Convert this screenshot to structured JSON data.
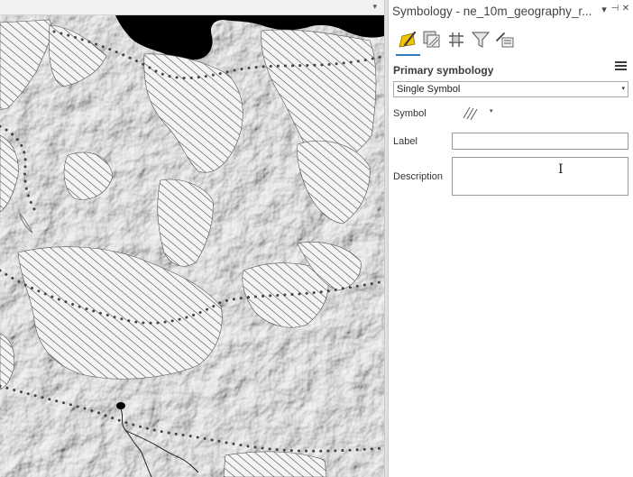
{
  "map": {
    "dropdown_icon": "chevron-down-icon"
  },
  "pane": {
    "title": "Symbology - ne_10m_geography_r...",
    "title_buttons": {
      "dropdown": "▾",
      "pin": "⊣",
      "close": "✕"
    },
    "tabs": [
      {
        "name": "primary-symbology",
        "icon": "paintbrush-icon",
        "active": true
      },
      {
        "name": "vary-symbology",
        "icon": "layers-icon",
        "active": false
      },
      {
        "name": "symbol-layer-drawing",
        "icon": "grid-hash-icon",
        "active": false
      },
      {
        "name": "symbol-classes",
        "icon": "filter-icon",
        "active": false
      },
      {
        "name": "label-classes",
        "icon": "list-edit-icon",
        "active": false
      }
    ],
    "menu_icon": "hamburger-icon",
    "section_heading": "Primary symbology",
    "renderer": {
      "value": "Single Symbol",
      "arrow": "▾"
    },
    "fields": {
      "symbol_label": "Symbol",
      "symbol_arrow": "▾",
      "label_label": "Label",
      "label_value": "",
      "description_label": "Description",
      "description_value": ""
    },
    "cursor_glyph": "I"
  },
  "colors": {
    "accent": "#2d7dbe",
    "hatch": "#3c3c3c",
    "water": "#000000",
    "paint_yellow": "#f2c400"
  }
}
